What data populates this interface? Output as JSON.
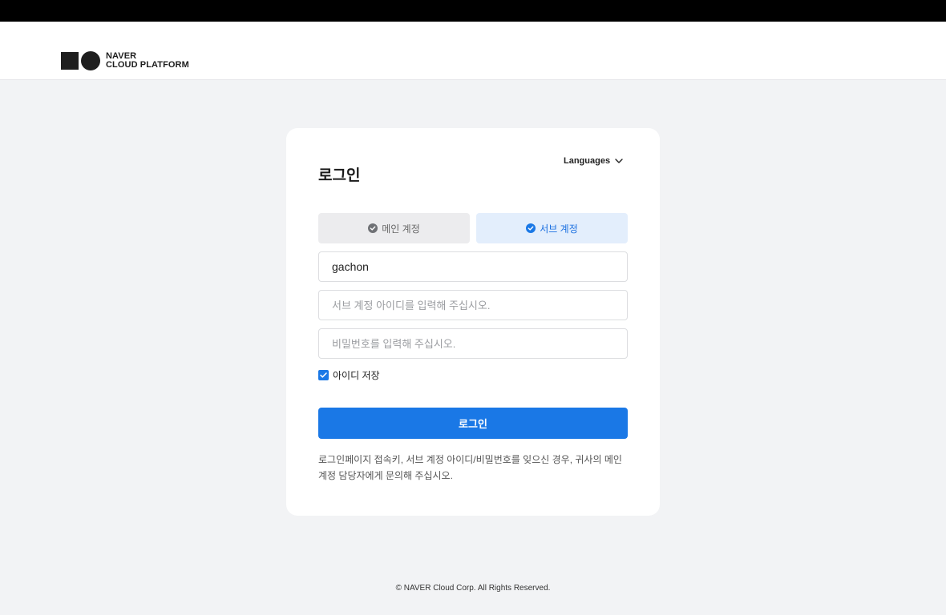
{
  "header": {
    "logo_line1": "NAVER",
    "logo_line2": "CLOUD PLATFORM"
  },
  "login": {
    "title": "로그인",
    "languages_label": "Languages",
    "tabs": [
      {
        "label": "메인 계정",
        "active": false
      },
      {
        "label": "서브 계정",
        "active": true
      }
    ],
    "login_key_value": "gachon",
    "sub_id_placeholder": "서브 계정 아이디를 입력해 주십시오.",
    "password_placeholder": "비밀번호를 입력해 주십시오.",
    "remember_label": "아이디 저장",
    "remember_checked": true,
    "submit_label": "로그인",
    "help_text": "로그인페이지 접속키, 서브 계정 아이디/비밀번호를 잊으신 경우, 귀사의 메인 계정 담당자에게 문의해 주십시오."
  },
  "footer": {
    "copyright": "© NAVER Cloud Corp. All Rights Reserved."
  },
  "colors": {
    "accent": "#1a78e6",
    "active_tab_bg": "#e3eefc",
    "inactive_tab_bg": "#ececee",
    "page_bg": "#f2f3f5"
  },
  "icons": {
    "tab_icon": "check-circle-icon",
    "languages_icon": "chevron-down-icon",
    "remember_icon": "checkbox-checked-icon"
  }
}
